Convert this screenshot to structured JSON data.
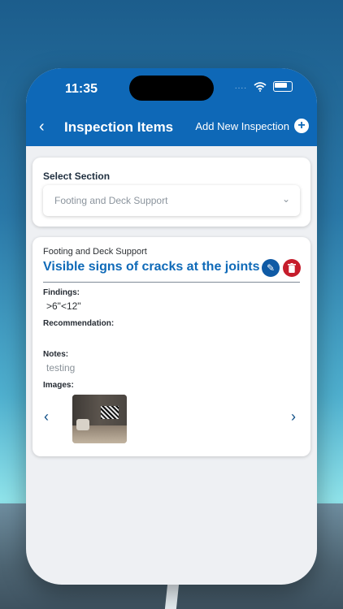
{
  "status": {
    "time": "11:35",
    "signal_dots": "...."
  },
  "header": {
    "back_glyph": "‹",
    "title": "Inspection Items",
    "add_label": "Add New Inspection",
    "add_glyph": "+"
  },
  "section_card": {
    "label": "Select Section",
    "selected": "Footing and Deck Support",
    "chevron": "⌄"
  },
  "item": {
    "section": "Footing and Deck Support",
    "title": "Visible signs of cracks at the joints",
    "edit_glyph": "✎",
    "delete_glyph": "🗑",
    "findings_label": "Findings:",
    "findings_value": ">6\"<12\"",
    "recommendation_label": "Recommendation:",
    "notes_label": "Notes:",
    "notes_value": "testing",
    "images_label": "Images:",
    "prev_glyph": "‹",
    "next_glyph": "›"
  },
  "colors": {
    "primary": "#0e68b7",
    "title_blue": "#0f6ab8",
    "delete_red": "#c61d2c",
    "background": "#eef0f3"
  }
}
